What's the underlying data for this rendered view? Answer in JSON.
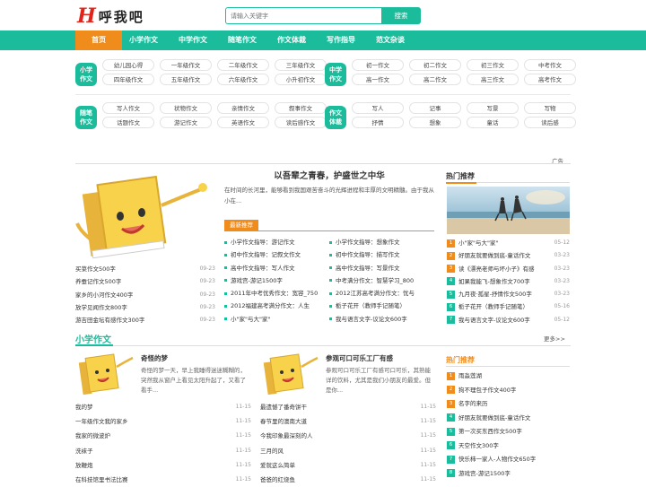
{
  "header": {
    "logo_letter": "H",
    "logo_text": "呼我吧",
    "search_placeholder": "请输入关键字",
    "search_button": "搜索"
  },
  "nav": [
    "首页",
    "小学作文",
    "中学作文",
    "随笔作文",
    "作文体裁",
    "写作指导",
    "范文杂谈"
  ],
  "categories": [
    {
      "badge": [
        "小学",
        "作文"
      ],
      "links": [
        "幼儿园心得",
        "一年级作文",
        "二年级作文",
        "三年级作文",
        "四年级作文",
        "五年级作文",
        "六年级作文",
        "小升初作文"
      ]
    },
    {
      "badge": [
        "中学",
        "作文"
      ],
      "links": [
        "初一作文",
        "初二作文",
        "初三作文",
        "中考作文",
        "高一作文",
        "高二作文",
        "高三作文",
        "高考作文"
      ]
    },
    {
      "badge": [
        "随笔",
        "作文"
      ],
      "links": [
        "写人作文",
        "状物作文",
        "亲情作文",
        "叙事作文",
        "话题作文",
        "游记作文",
        "英语作文",
        "读后感作文"
      ]
    },
    {
      "badge": [
        "作文",
        "体裁"
      ],
      "links": [
        "写人",
        "记事",
        "写景",
        "写物",
        "抒情",
        "想象",
        "童话",
        "读后感"
      ]
    }
  ],
  "ad_label": "广告",
  "latest": [
    {
      "t": "买菜作文500字",
      "d": "09-23"
    },
    {
      "t": "养蚕记作文500字",
      "d": "09-23"
    },
    {
      "t": "家乡的小河作文400字",
      "d": "09-23"
    },
    {
      "t": "放学见闻作文800字",
      "d": "09-23"
    },
    {
      "t": "游吉田金坛有感作文300字",
      "d": "09-23"
    }
  ],
  "headline": "以吾辈之青春，护盛世之中华",
  "summary": "在时间的长河里，能够看到我国艰苦奋斗的光辉进程和丰厚的文明精髓。由于我从小在...",
  "new_label": "最新推荐",
  "new_left": [
    "小学作文指导：游记作文",
    "初中作文指导：记叙文作文",
    "高中作文指导：写人作文",
    "游戏宫-游记1500字",
    "2011年中考优秀作文：宽容_750",
    "2012福建高考满分作文：人生",
    "小\"家\"与大\"家\""
  ],
  "new_right": [
    "小学作文指导：想象作文",
    "初中作文指导：描写作文",
    "高中作文指导：写景作文",
    "中考满分作文：智慧学习_800",
    "2012江苏高考满分作文：忧与",
    "栀子花开（教师手记随笔）",
    "我与语言文字-议论文600字"
  ],
  "hot_title": "热门推荐",
  "hot": [
    {
      "n": "1",
      "t": "小\"家\"与大\"家\"",
      "d": "05-12"
    },
    {
      "n": "2",
      "t": "好朋友就要做到底-童话作文",
      "d": "03-23"
    },
    {
      "n": "3",
      "t": "读《漂亮老师与坏小子》有感",
      "d": "03-23"
    },
    {
      "n": "4",
      "t": "如果我能飞-想象作文700字",
      "d": "03-23"
    },
    {
      "n": "5",
      "t": "九月夜·孤星-抒情作文500字",
      "d": "03-23"
    },
    {
      "n": "6",
      "t": "栀子花开（教师手记随笔）",
      "d": "05-16"
    },
    {
      "n": "7",
      "t": "我与语言文字-议论文600字",
      "d": "05-12"
    }
  ],
  "sec2": {
    "title": "小学作文",
    "more": "更多>>"
  },
  "articles": [
    {
      "title": "奇怪的梦",
      "desc": "奇怪的梦一天，早上我睡得迷迷糊糊的，突然我从窗户上看见太阳升起了，又看了看手..."
    },
    {
      "title": "参观可口可乐工厂有感",
      "desc": "参观可口可乐工厂有感可口可乐，其熟能详的饮料，尤其是我们小朋友的最爱。但是你..."
    }
  ],
  "list_left": [
    {
      "t": "我的梦",
      "d": "11-15"
    },
    {
      "t": "一年级作文我的家乡",
      "d": "11-15"
    },
    {
      "t": "我家的微波炉",
      "d": "11-15"
    },
    {
      "t": "洗袜子",
      "d": "11-15"
    },
    {
      "t": "放鞭炮",
      "d": "11-15"
    },
    {
      "t": "在科技馆里书法比赛",
      "d": "11-15"
    }
  ],
  "list_right": [
    {
      "t": "最遗憾了番奇饼干",
      "d": "11-15"
    },
    {
      "t": "春节里的澳南大道",
      "d": "11-15"
    },
    {
      "t": "今我印象最深刻的人",
      "d": "11-15"
    },
    {
      "t": "三月的风",
      "d": "11-15"
    },
    {
      "t": "爱就这么简单",
      "d": "11-15"
    },
    {
      "t": "爸爸的红烧鱼",
      "d": "11-15"
    }
  ],
  "hot2_title": "热门推荐",
  "hot2": [
    "雨淼莲湖",
    "狗不理包子作文400字",
    "名字的来历",
    "好朋友就要做到底-童话作文",
    "第一次买东西作文500字",
    "天空作文300字",
    "快乐柿一家人-人物作文650字",
    "游戏宫-游记1500字"
  ],
  "colors": {
    "accent": "#1bbc9b",
    "orange": "#f08c1c",
    "logo_red": "#e2231a"
  }
}
